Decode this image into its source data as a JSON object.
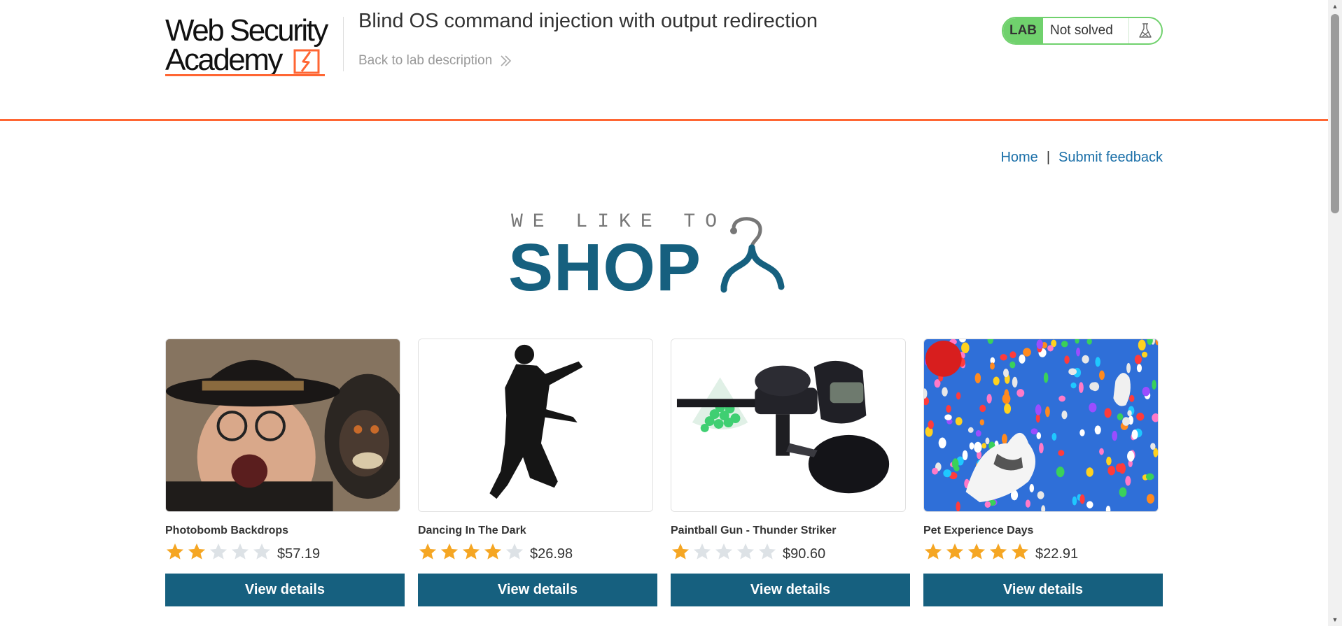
{
  "academy": {
    "logo_line1": "Web Security",
    "logo_line2": "Academy",
    "lab_title": "Blind OS command injection with output redirection",
    "back_link": "Back to lab description",
    "lab_badge": "LAB",
    "lab_status": "Not solved"
  },
  "nav": {
    "home": "Home",
    "separator": "|",
    "feedback": "Submit feedback"
  },
  "shop_logo": {
    "tagline": "WE LIKE TO",
    "word": "SHOP"
  },
  "colors": {
    "accent_orange": "#ff6633",
    "brand_blue": "#16607f",
    "link_blue": "#1a6fa8",
    "lab_green": "#70d16d",
    "star_filled": "#f5a623",
    "star_empty": "#dde2e6"
  },
  "products": [
    {
      "name": "Photobomb Backdrops",
      "rating": 2,
      "max_rating": 5,
      "price": "$57.19",
      "button": "View details",
      "image_icon": "photobomb-image"
    },
    {
      "name": "Dancing In The Dark",
      "rating": 4,
      "max_rating": 5,
      "price": "$26.98",
      "button": "View details",
      "image_icon": "dancer-silhouette-image"
    },
    {
      "name": "Paintball Gun - Thunder Striker",
      "rating": 1,
      "max_rating": 5,
      "price": "$90.60",
      "button": "View details",
      "image_icon": "paintball-gun-image"
    },
    {
      "name": "Pet Experience Days",
      "rating": 5,
      "max_rating": 5,
      "price": "$22.91",
      "button": "View details",
      "image_icon": "balloon-dogs-image"
    }
  ]
}
